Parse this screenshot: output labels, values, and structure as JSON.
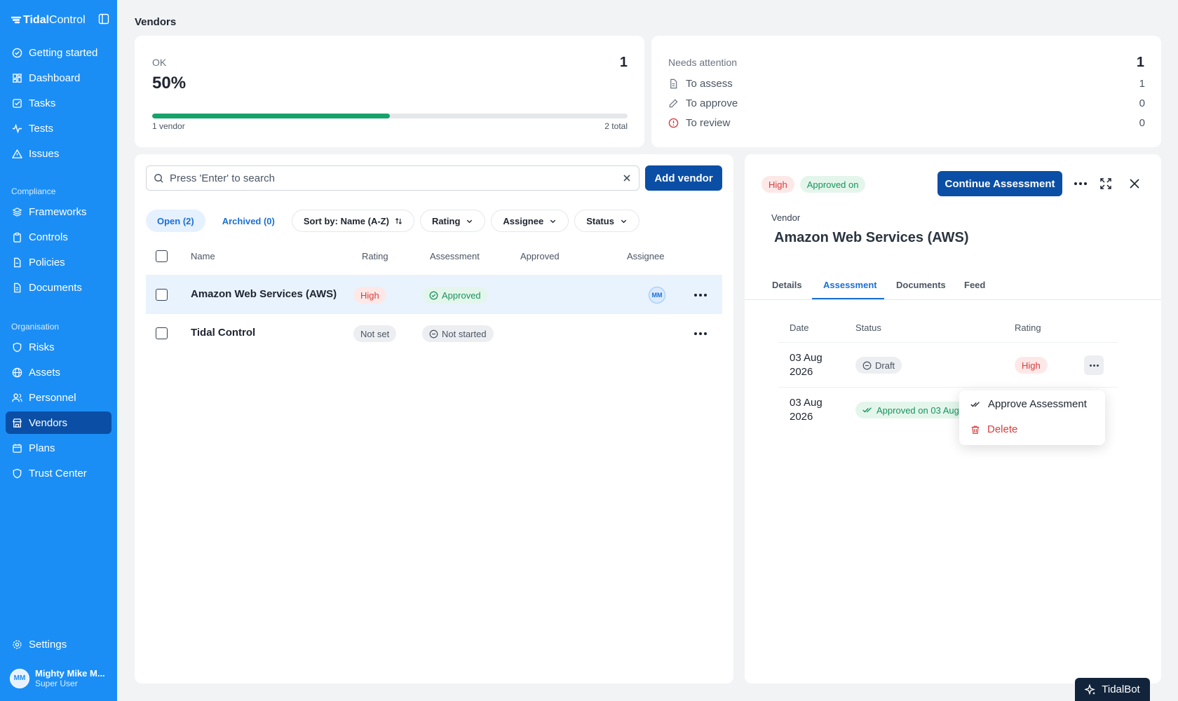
{
  "brand": {
    "name_bold": "Tidal",
    "name_rest": "Control"
  },
  "sidebar": {
    "items_top": [
      {
        "label": "Getting started",
        "icon": "check-circle-icon"
      },
      {
        "label": "Dashboard",
        "icon": "grid-icon"
      },
      {
        "label": "Tasks",
        "icon": "checkbox-icon"
      },
      {
        "label": "Tests",
        "icon": "pulse-icon"
      },
      {
        "label": "Issues",
        "icon": "warning-icon"
      }
    ],
    "section_compliance": "Compliance",
    "items_compliance": [
      {
        "label": "Frameworks",
        "icon": "layers-icon"
      },
      {
        "label": "Controls",
        "icon": "clipboard-icon"
      },
      {
        "label": "Policies",
        "icon": "file-icon"
      },
      {
        "label": "Documents",
        "icon": "document-icon"
      }
    ],
    "section_org": "Organisation",
    "items_org": [
      {
        "label": "Risks",
        "icon": "shield-icon"
      },
      {
        "label": "Assets",
        "icon": "globe-icon"
      },
      {
        "label": "Personnel",
        "icon": "users-icon"
      },
      {
        "label": "Vendors",
        "icon": "store-icon",
        "active": true
      },
      {
        "label": "Plans",
        "icon": "calendar-icon"
      },
      {
        "label": "Trust Center",
        "icon": "shield-check-icon"
      }
    ],
    "settings": "Settings",
    "user": {
      "initials": "MM",
      "name": "Mighty Mike M...",
      "role": "Super User"
    }
  },
  "page": {
    "title": "Vendors"
  },
  "stats_ok": {
    "label": "OK",
    "count": "1",
    "percent": "50%",
    "progress": 0.5,
    "left_caption": "1 vendor",
    "right_caption": "2 total"
  },
  "stats_attention": {
    "label": "Needs attention",
    "count": "1",
    "rows": [
      {
        "label": "To assess",
        "value": "1"
      },
      {
        "label": "To approve",
        "value": "0"
      },
      {
        "label": "To review",
        "value": "0"
      }
    ]
  },
  "list": {
    "search_placeholder": "Press 'Enter' to search",
    "add_button": "Add vendor",
    "tabs": [
      "Open (2)",
      "Archived (0)"
    ],
    "filters": [
      "Sort by: Name (A-Z)",
      "Rating",
      "Assignee",
      "Status"
    ],
    "columns": [
      "Name",
      "Rating",
      "Assessment",
      "Approved",
      "Assignee"
    ],
    "rows": [
      {
        "name": "Amazon Web Services (AWS)",
        "rating": "High",
        "assessment": "Approved",
        "approved": "",
        "assignee": "MM"
      },
      {
        "name": "Tidal Control",
        "rating": "Not set",
        "assessment": "Not started",
        "approved": "",
        "assignee": ""
      }
    ]
  },
  "detail": {
    "rating_badge": "High",
    "status_badge": "Approved on",
    "continue_button": "Continue Assessment",
    "vendor_label": "Vendor",
    "vendor_name": "Amazon Web Services (AWS)",
    "tabs": [
      "Details",
      "Assessment",
      "Documents",
      "Feed"
    ],
    "active_tab": "Assessment",
    "columns": [
      "Date",
      "Status",
      "Rating"
    ],
    "rows": [
      {
        "date_line1": "03 Aug",
        "date_line2": "2026",
        "status": "Draft",
        "rating": "High"
      },
      {
        "date_line1": "03 Aug",
        "date_line2": "2026",
        "status": "Approved on 03 Aug",
        "rating": ""
      }
    ],
    "menu": {
      "approve": "Approve Assessment",
      "delete": "Delete"
    }
  },
  "tidalbot": "TidalBot",
  "colors": {
    "sidebar": "#1b8ef6",
    "primary": "#0a4fa5",
    "success": "#16a36a",
    "danger": "#d93c3c"
  }
}
